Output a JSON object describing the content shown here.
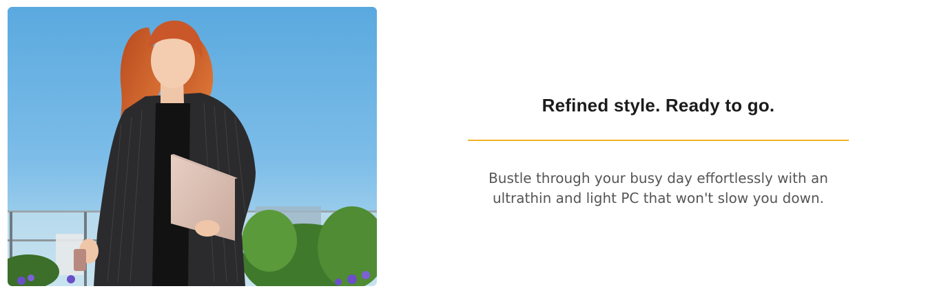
{
  "hero": {
    "image_alt": "Woman with red hair in a pinstripe blazer carrying a light pink laptop and a phone outdoors under a blue sky"
  },
  "content": {
    "headline": "Refined style. Ready to go.",
    "body": "Bustle through your busy day effortlessly with an ultrathin and light PC that won't slow you down."
  },
  "colors": {
    "divider": "#f0b323",
    "headline": "#1c1c1c",
    "body": "#555555",
    "sky": "#5eaee2"
  }
}
